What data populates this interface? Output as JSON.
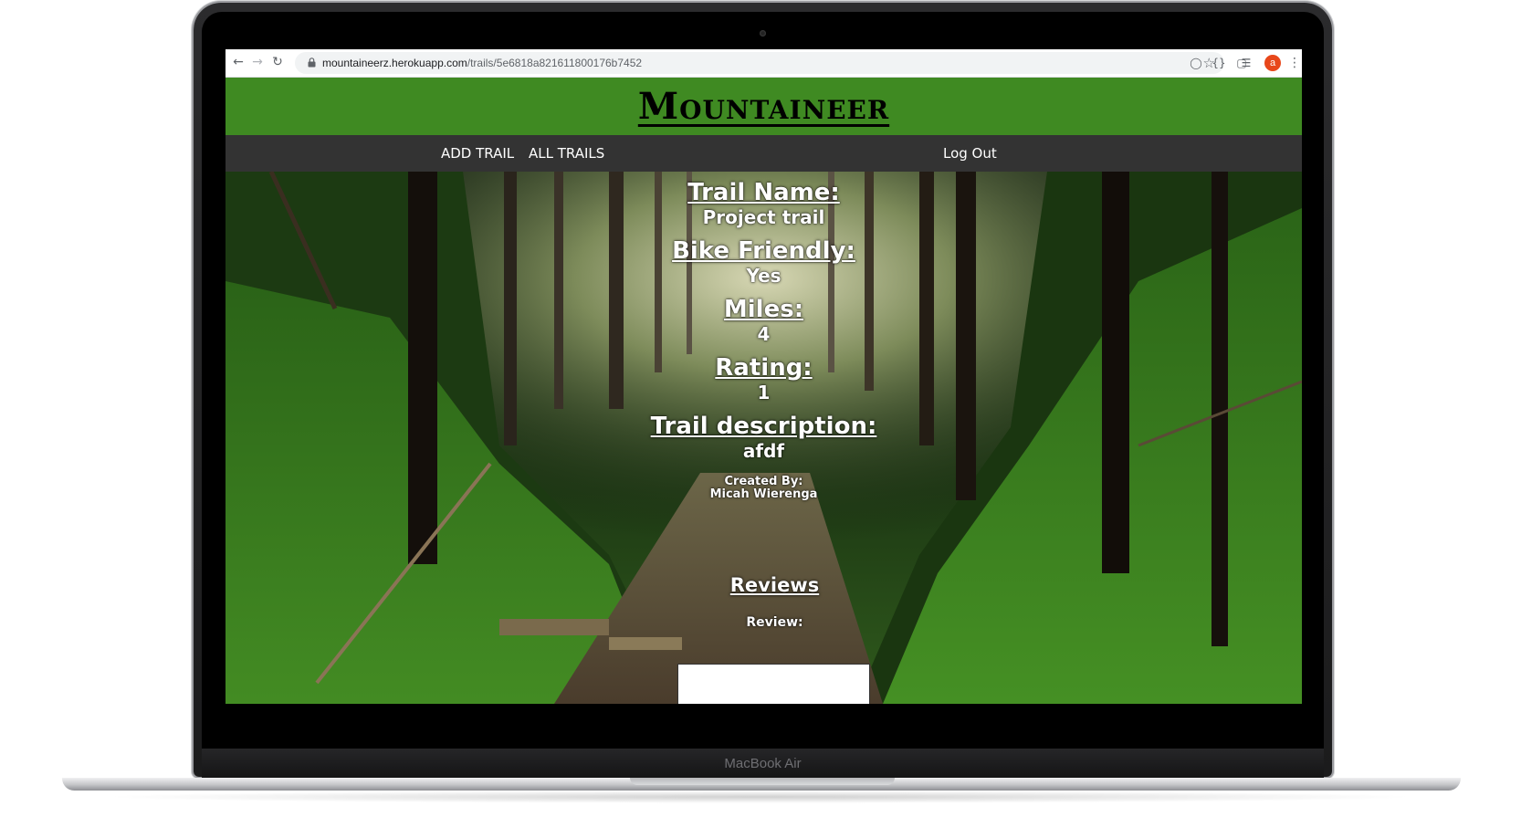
{
  "device": {
    "label": "MacBook Air"
  },
  "browser": {
    "url_host": "mountaineerz.herokuapp.com",
    "url_path": "/trails/5e6818a821611800176b7452",
    "avatar_letter": "a"
  },
  "site": {
    "brand": "Mountaineer",
    "nav": {
      "add_trail": "ADD TRAIL",
      "all_trails": "ALL TRAILS",
      "logout": "Log Out"
    }
  },
  "trail": {
    "name_label": "Trail Name:",
    "name": "Project trail",
    "bike_label": "Bike Friendly:",
    "bike": "Yes",
    "miles_label": "Miles:",
    "miles": "4",
    "rating_label": "Rating:",
    "rating": "1",
    "desc_label": "Trail description:",
    "desc": "afdf",
    "created_by_label": "Created By:",
    "created_by": "Micah Wierenga"
  },
  "reviews": {
    "heading": "Reviews",
    "review_label": "Review:"
  },
  "colors": {
    "header_green": "#3f8a22",
    "nav_dark": "#333333",
    "avatar": "#e8471a"
  }
}
